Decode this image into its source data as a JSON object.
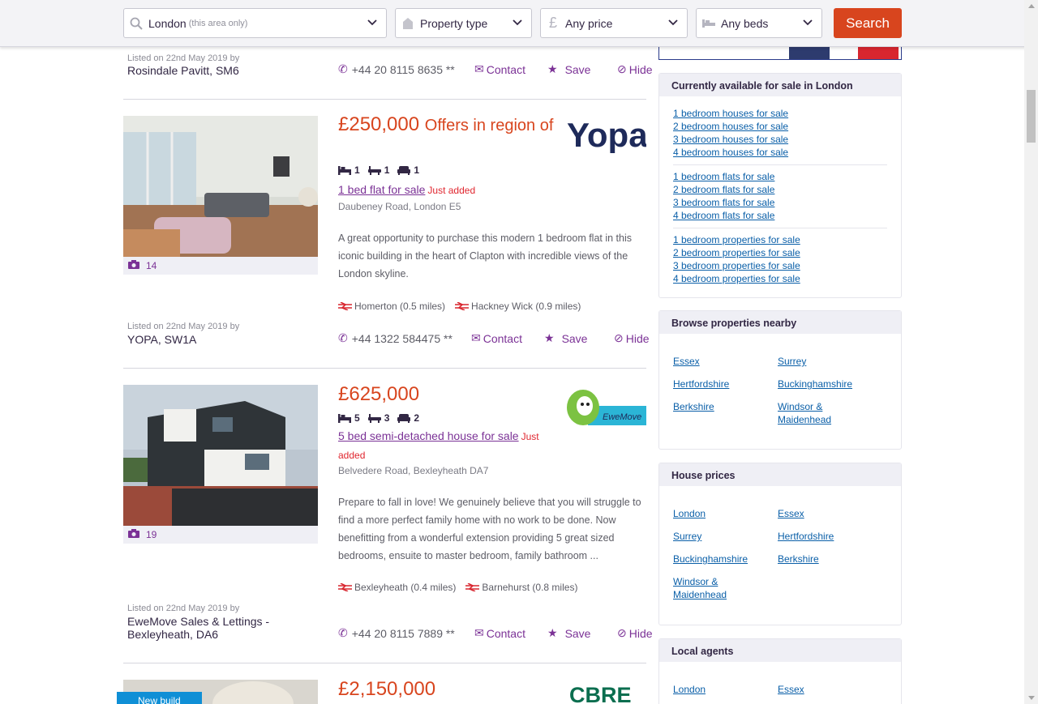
{
  "search": {
    "location_value": "London",
    "location_hint": "(this area only)",
    "property_type": "Property type",
    "price": "Any price",
    "beds": "Any beds",
    "search_button": "Search"
  },
  "listings": [
    {
      "listed": "Listed on 22nd May 2019 by",
      "agent": "Rosindale Pavitt, SM6",
      "phone": "+44 20 8115 8635 **",
      "contact": "Contact",
      "save": "Save",
      "hide": "Hide"
    },
    {
      "price": "£250,000",
      "price_qualifier": "Offers in region of",
      "beds": "1",
      "baths": "1",
      "receptions": "1",
      "title": "1 bed flat for sale",
      "badge": "Just added",
      "address": "Daubeney Road, London E5",
      "description": "A great opportunity to purchase this modern 1 bedroom flat in this iconic building in the heart of Clapton with incredible views of the London skyline.",
      "stations": [
        "Homerton (0.5 miles)",
        "Hackney Wick (0.9 miles)"
      ],
      "photo_count": "14",
      "listed": "Listed on 22nd May 2019 by",
      "agent": "YOPA, SW1A",
      "phone": "+44 1322 584475 **",
      "contact": "Contact",
      "save": "Save",
      "hide": "Hide",
      "logo_text": "Yopa"
    },
    {
      "price": "£625,000",
      "beds": "5",
      "baths": "3",
      "receptions": "2",
      "title": "5 bed semi-detached house for sale",
      "badge": "Just added",
      "address": "Belvedere Road, Bexleyheath DA7",
      "description": "Prepare to fall in love! We genuinely believe that you will struggle to find a more perfect family home with no work to be done. Now benefitting from a wonderful extension providing 5 great sized bedrooms, ensuite to master bedroom, family bathroom ...",
      "stations": [
        "Bexleyheath (0.4 miles)",
        "Barnehurst (0.8 miles)"
      ],
      "photo_count": "19",
      "listed": "Listed on 22nd May 2019 by",
      "agent": "EweMove Sales & Lettings - Bexleyheath, DA6",
      "phone": "+44 20 8115 7889 **",
      "contact": "Contact",
      "save": "Save",
      "hide": "Hide",
      "logo_text": "EweMove"
    },
    {
      "price": "£2,150,000",
      "badge": "New build",
      "logo_text": "CBRE"
    }
  ],
  "sidebar": {
    "available": {
      "title": "Currently available for sale in London",
      "houses": [
        "1 bedroom houses for sale",
        "2 bedroom houses for sale",
        "3 bedroom houses for sale",
        "4 bedroom houses for sale"
      ],
      "flats": [
        "1 bedroom flats for sale",
        "2 bedroom flats for sale",
        "3 bedroom flats for sale",
        "4 bedroom flats for sale"
      ],
      "properties": [
        "1 bedroom properties for sale",
        "2 bedroom properties for sale",
        "3 bedroom properties for sale",
        "4 bedroom properties for sale"
      ]
    },
    "nearby": {
      "title": "Browse properties nearby",
      "links": [
        "Essex",
        "Surrey",
        "Hertfordshire",
        "Buckinghamshire",
        "Berkshire",
        "Windsor & Maidenhead"
      ]
    },
    "prices": {
      "title": "House prices",
      "links": [
        "London",
        "Essex",
        "Surrey",
        "Hertfordshire",
        "Buckinghamshire",
        "Berkshire",
        "Windsor & Maidenhead"
      ]
    },
    "agents": {
      "title": "Local agents",
      "links": [
        "London",
        "Essex"
      ]
    }
  },
  "colors": {
    "price": "#d8451e",
    "accent": "#7b3296",
    "search_button": "#d8451e",
    "link": "#0a5fa8",
    "just_added": "#e0262f"
  },
  "icons": [
    "search-icon",
    "chevron-down-icon",
    "house-icon",
    "pound-icon",
    "bed-icon",
    "phone-icon",
    "envelope-icon",
    "star-icon",
    "hide-icon",
    "camera-icon",
    "bath-icon",
    "sofa-icon",
    "rail-icon"
  ]
}
